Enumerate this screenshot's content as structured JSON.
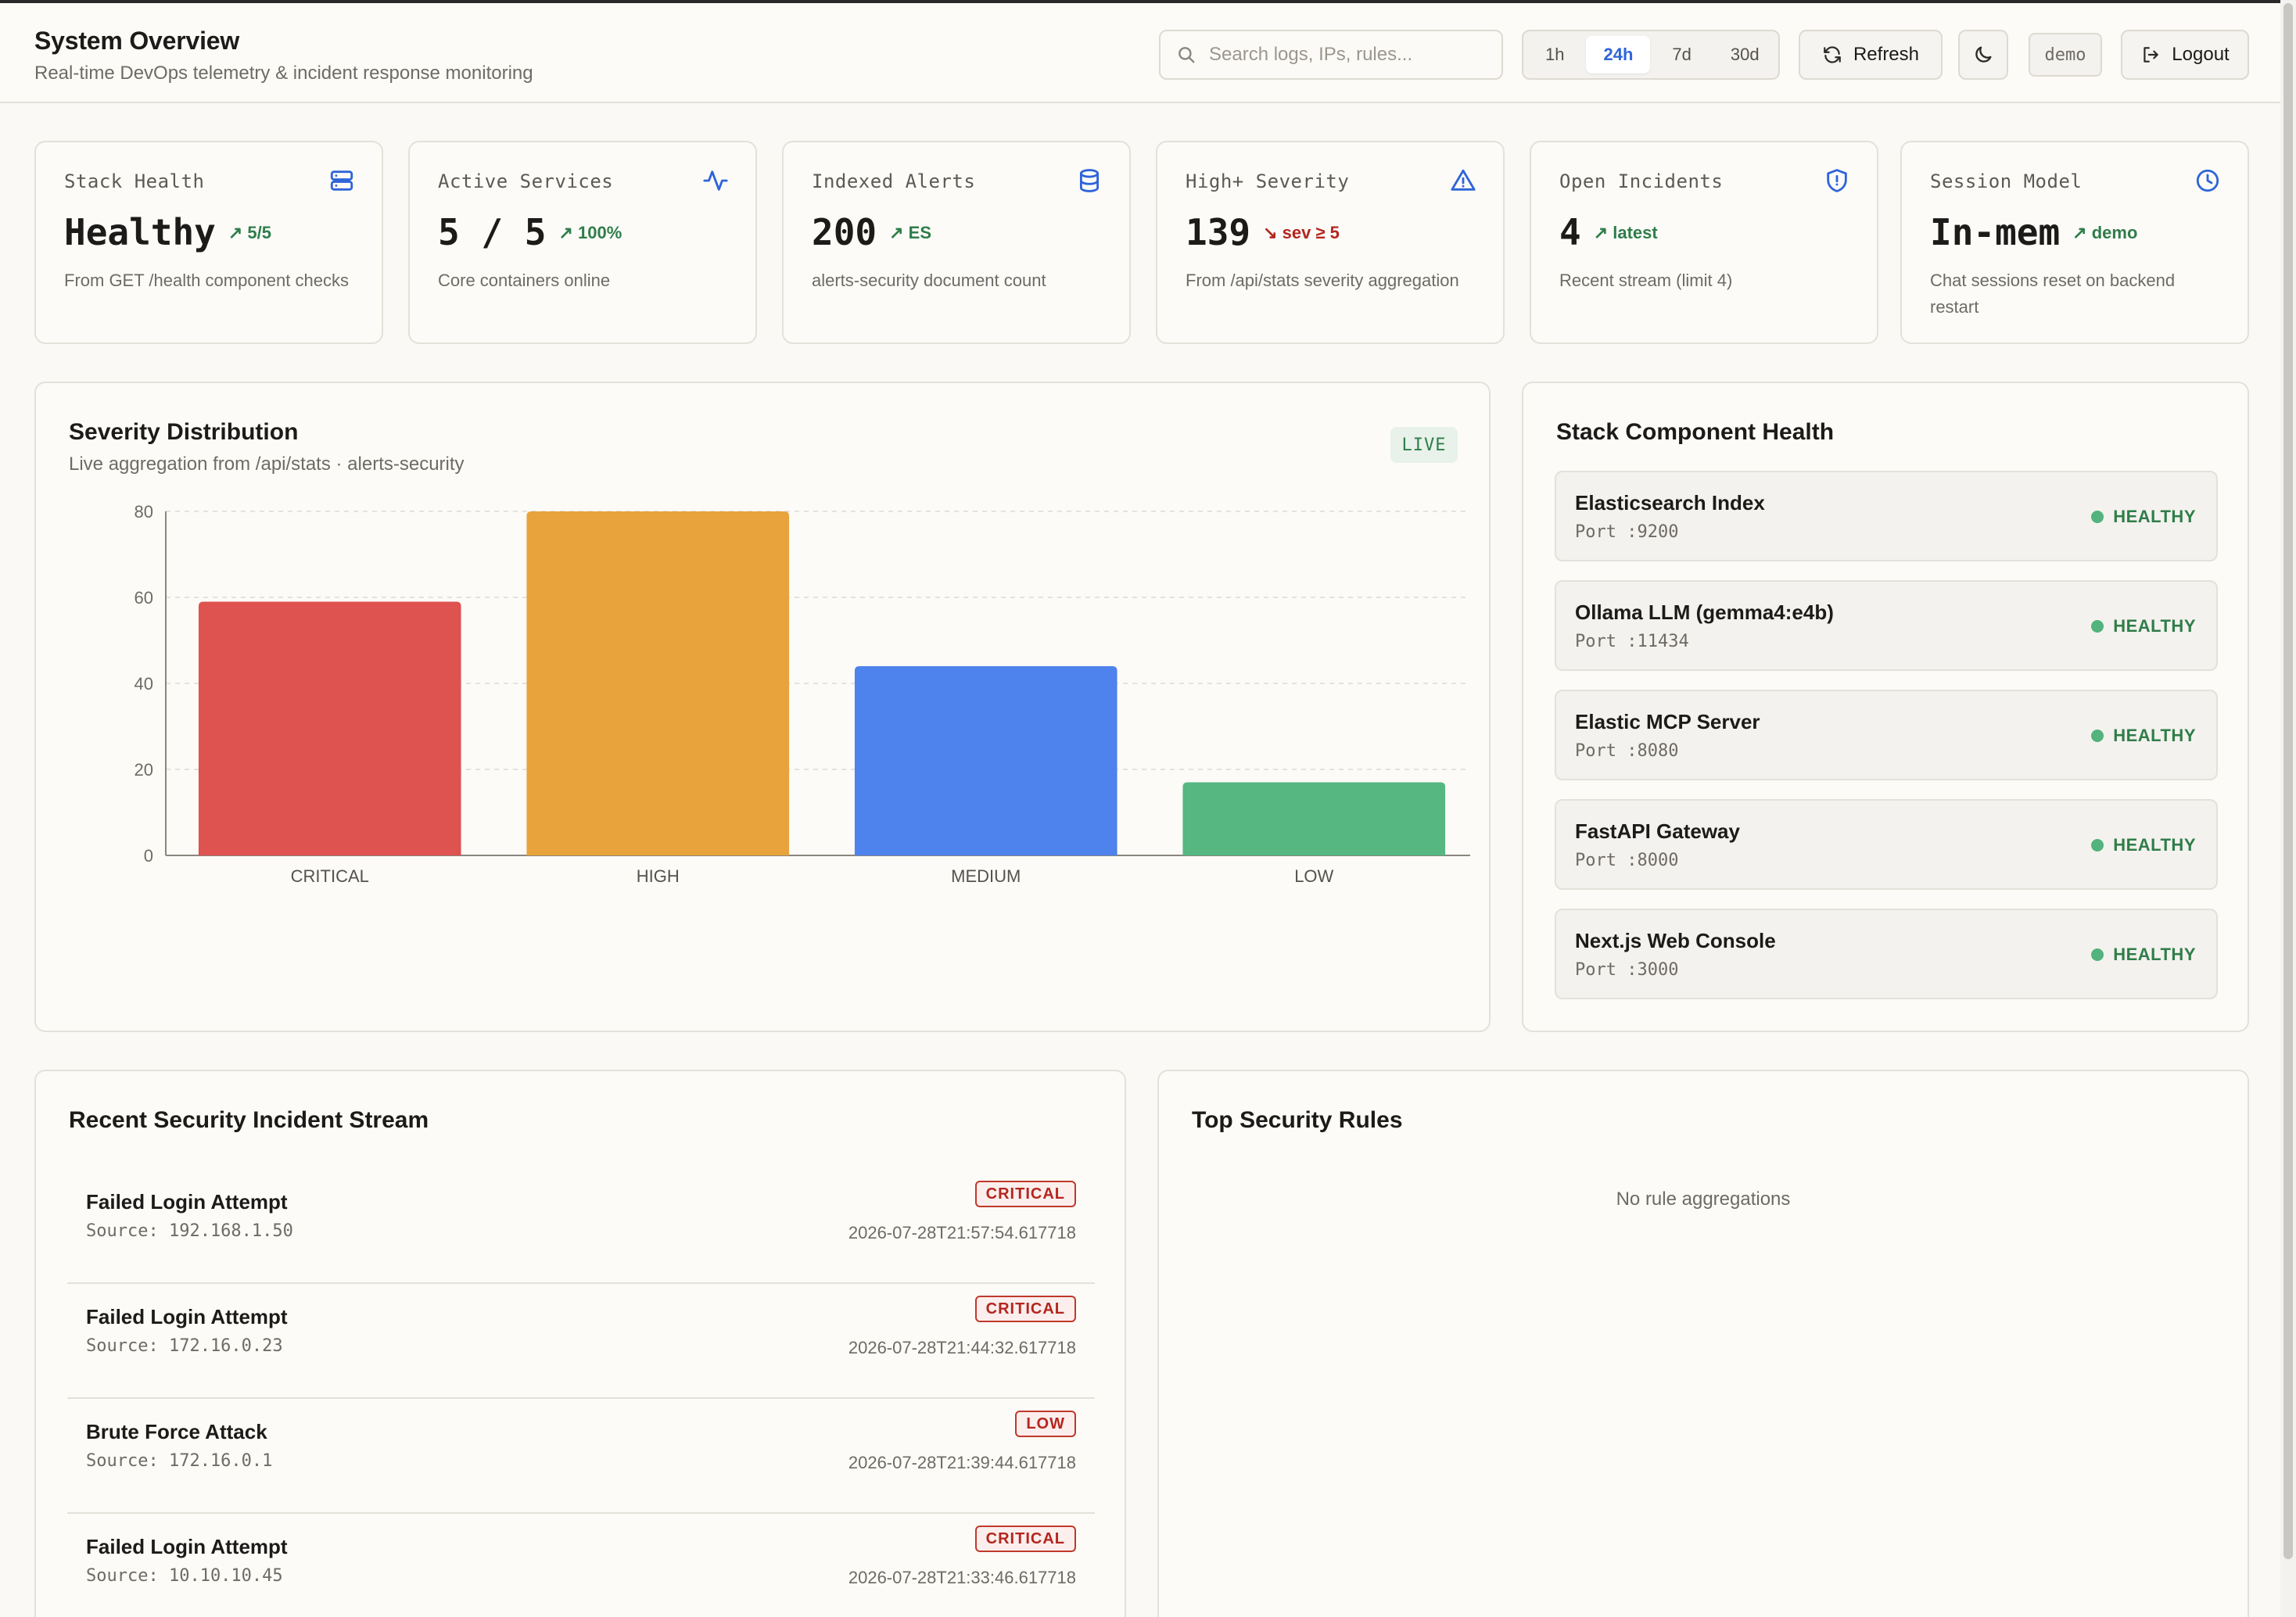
{
  "header": {
    "title": "System Overview",
    "subtitle": "Real-time DevOps telemetry & incident response monitoring",
    "search_placeholder": "Search logs, IPs, rules...",
    "ranges": [
      "1h",
      "24h",
      "7d",
      "30d"
    ],
    "active_range": "24h",
    "refresh_label": "Refresh",
    "user": "demo",
    "logout_label": "Logout"
  },
  "stats": [
    {
      "label": "Stack Health",
      "value": "Healthy",
      "delta": "5/5",
      "trend": "up",
      "desc": "From GET /health component checks",
      "icon": "server-icon"
    },
    {
      "label": "Active Services",
      "value": "5 / 5",
      "delta": "100%",
      "trend": "up",
      "desc": "Core containers online",
      "icon": "activity-icon"
    },
    {
      "label": "Indexed Alerts",
      "value": "200",
      "delta": "ES",
      "trend": "up",
      "desc": "alerts-security document count",
      "icon": "database-icon"
    },
    {
      "label": "High+ Severity",
      "value": "139",
      "delta": "sev ≥ 5",
      "trend": "down",
      "desc": "From /api/stats severity aggregation",
      "icon": "warning-icon"
    },
    {
      "label": "Open Incidents",
      "value": "4",
      "delta": "latest",
      "trend": "up",
      "desc": "Recent stream (limit 4)",
      "icon": "shield-icon"
    },
    {
      "label": "Session Model",
      "value": "In-mem",
      "delta": "demo",
      "trend": "up",
      "desc": "Chat sessions reset on backend restart",
      "icon": "clock-icon"
    }
  ],
  "severity_card": {
    "title": "Severity Distribution",
    "subtitle": "Live aggregation from /api/stats · alerts-security",
    "badge": "LIVE"
  },
  "chart_data": {
    "type": "bar",
    "categories": [
      "CRITICAL",
      "HIGH",
      "MEDIUM",
      "LOW"
    ],
    "values": [
      59,
      80,
      44,
      17
    ],
    "colors": [
      "#de524f",
      "#e8a33c",
      "#4e82ec",
      "#56b780"
    ],
    "ylim": [
      0,
      80
    ],
    "yticks": [
      0,
      20,
      40,
      60,
      80
    ],
    "grid": true,
    "title": "",
    "xlabel": "",
    "ylabel": ""
  },
  "health": {
    "title": "Stack Component Health",
    "items": [
      {
        "name": "Elasticsearch Index",
        "port": "Port :9200",
        "status": "HEALTHY"
      },
      {
        "name": "Ollama LLM (gemma4:e4b)",
        "port": "Port :11434",
        "status": "HEALTHY"
      },
      {
        "name": "Elastic MCP Server",
        "port": "Port :8080",
        "status": "HEALTHY"
      },
      {
        "name": "FastAPI Gateway",
        "port": "Port :8000",
        "status": "HEALTHY"
      },
      {
        "name": "Next.js Web Console",
        "port": "Port :3000",
        "status": "HEALTHY"
      }
    ]
  },
  "incidents": {
    "title": "Recent Security Incident Stream",
    "items": [
      {
        "title": "Failed Login Attempt",
        "source": "Source: 192.168.1.50",
        "severity": "CRITICAL",
        "time": "2026-07-28T21:57:54.617718"
      },
      {
        "title": "Failed Login Attempt",
        "source": "Source: 172.16.0.23",
        "severity": "CRITICAL",
        "time": "2026-07-28T21:44:32.617718"
      },
      {
        "title": "Brute Force Attack",
        "source": "Source: 172.16.0.1",
        "severity": "LOW",
        "time": "2026-07-28T21:39:44.617718"
      },
      {
        "title": "Failed Login Attempt",
        "source": "Source: 10.10.10.45",
        "severity": "CRITICAL",
        "time": "2026-07-28T21:33:46.617718"
      }
    ]
  },
  "rules": {
    "title": "Top Security Rules",
    "empty": "No rule aggregations"
  }
}
